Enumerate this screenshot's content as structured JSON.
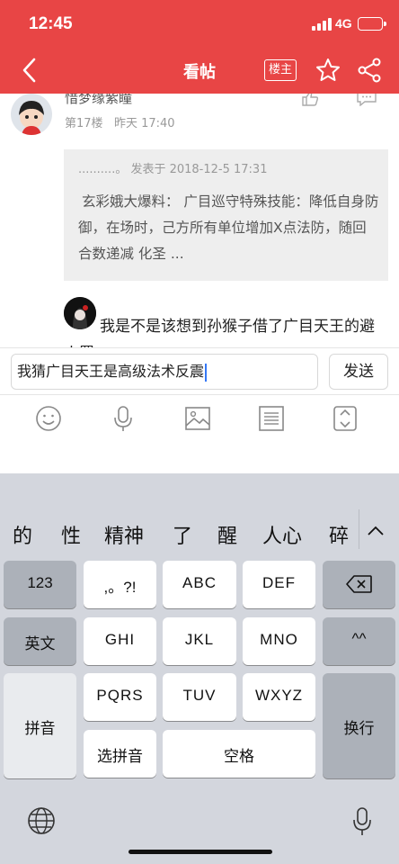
{
  "status_bar": {
    "time": "12:45",
    "network": "4G"
  },
  "header": {
    "title": "看帖",
    "louzhu_label": "楼主"
  },
  "post": {
    "username": "惜梦缘紫瞳",
    "floor": "第17楼",
    "time": "昨天 17:40",
    "quote_meta": "..........。 发表于 2018-12-5 17:31",
    "quote_text": "玄彩娥大爆料： 广目巡守特殊技能：降低自身防御，在场时，己方所有单位增加X点法防，随回合数递减 化圣 ...",
    "reply_text": "我是不是该想到孙猴子借了广目天王的避火罩"
  },
  "composer": {
    "input_value": "我猜广目天王是高级法术反震",
    "send_label": "发送"
  },
  "toolbar": [
    "emoji-icon",
    "voice-icon",
    "image-icon",
    "list-icon",
    "expand-icon"
  ],
  "keyboard": {
    "candidates": [
      "的",
      "性",
      "精神",
      "了",
      "醒",
      "人心",
      "碎"
    ],
    "keys": {
      "num": "123",
      "punct": ",。?!",
      "abc": "ABC",
      "def": "DEF",
      "english": "英文",
      "ghi": "GHI",
      "jkl": "JKL",
      "mno": "MNO",
      "emoticon": "^^",
      "pinyin": "拼音",
      "pqrs": "PQRS",
      "tuv": "TUV",
      "wxyz": "WXYZ",
      "newline": "换行",
      "select_pinyin": "选拼音",
      "space": "空格"
    }
  },
  "colors": {
    "brand_red": "#e84545",
    "keyboard_bg": "#d3d6dd",
    "caret": "#3478f6"
  }
}
